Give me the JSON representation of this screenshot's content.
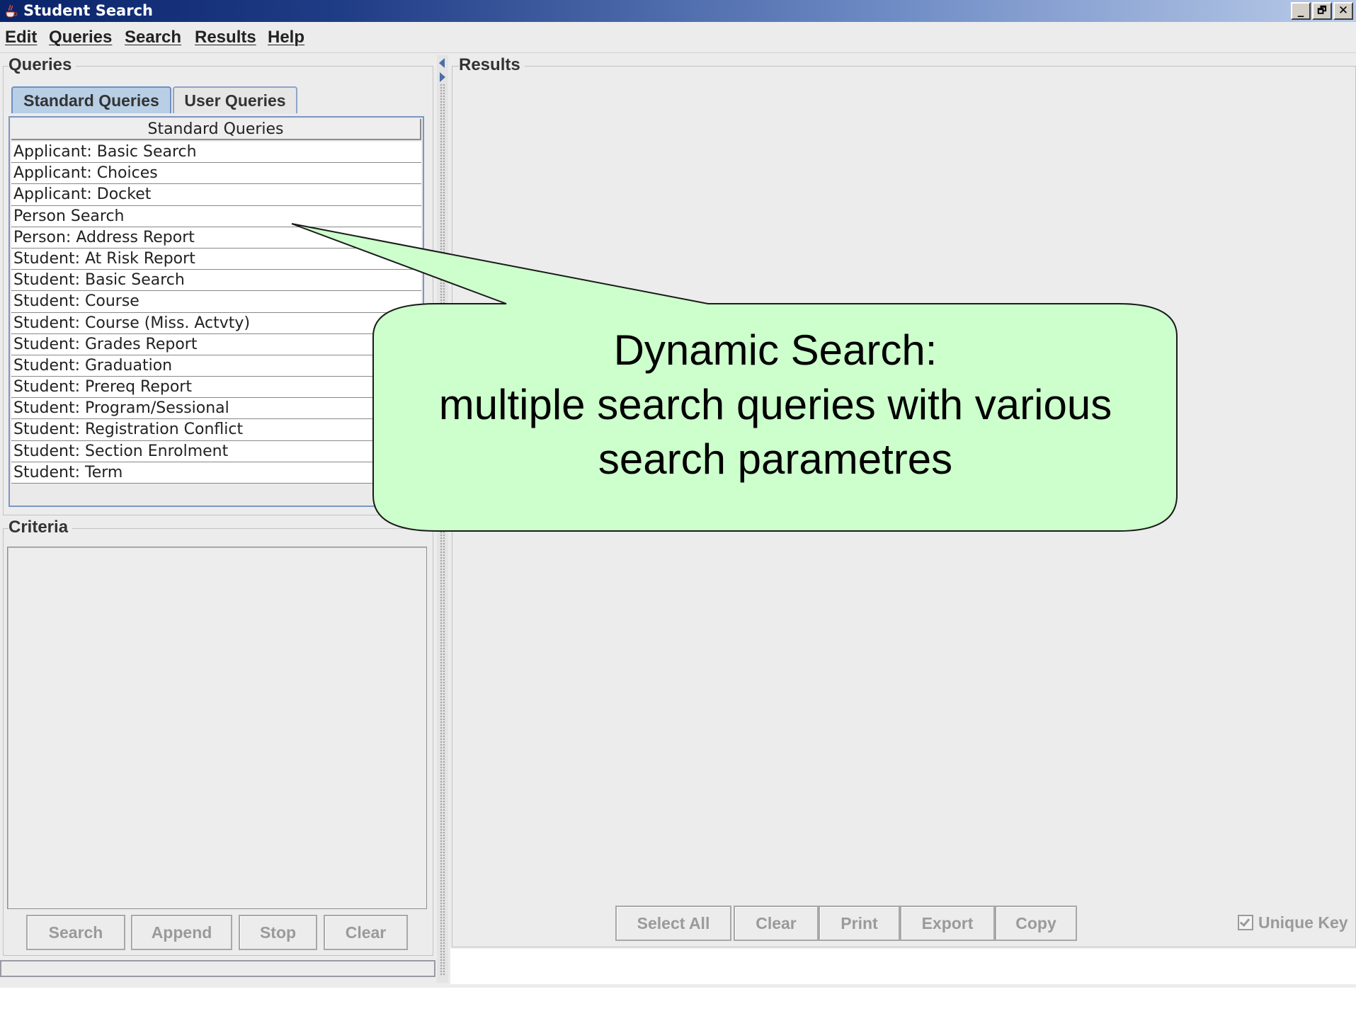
{
  "window": {
    "title": "Student Search",
    "controls": {
      "minimize": "_",
      "restore": "🗗",
      "close": "✕"
    }
  },
  "menubar": {
    "items": [
      "Edit",
      "Queries",
      "Search",
      "Results",
      "Help"
    ]
  },
  "queries_panel": {
    "title": "Queries",
    "tabs": [
      "Standard Queries",
      "User Queries"
    ],
    "list_header": "Standard Queries",
    "items": [
      "Applicant: Basic Search",
      "Applicant: Choices",
      "Applicant: Docket",
      "Person Search",
      "Person: Address Report",
      "Student: At Risk Report",
      "Student: Basic Search",
      "Student: Course",
      "Student: Course (Miss. Actvty)",
      "Student: Grades Report",
      "Student: Graduation",
      "Student: Prereq Report",
      "Student: Program/Sessional",
      "Student: Registration Conflict",
      "Student: Section Enrolment",
      "Student: Term"
    ]
  },
  "criteria_panel": {
    "title": "Criteria",
    "buttons": [
      "Search",
      "Append",
      "Stop",
      "Clear"
    ]
  },
  "results_panel": {
    "title": "Results",
    "buttons": [
      "Select All",
      "Clear",
      "Print",
      "Export",
      "Copy"
    ],
    "unique_key_label": "Unique Key",
    "unique_key_checked": true
  },
  "callout": {
    "lines": [
      "Dynamic Search:",
      "multiple search queries with various",
      "search parametres"
    ],
    "fill_color": "#ccffcc"
  },
  "colors": {
    "titlebar_start": "#0a246a",
    "titlebar_end": "#b9cbe9",
    "tab_active": "#b8cfe5",
    "disabled_text": "#9a9a9a"
  }
}
